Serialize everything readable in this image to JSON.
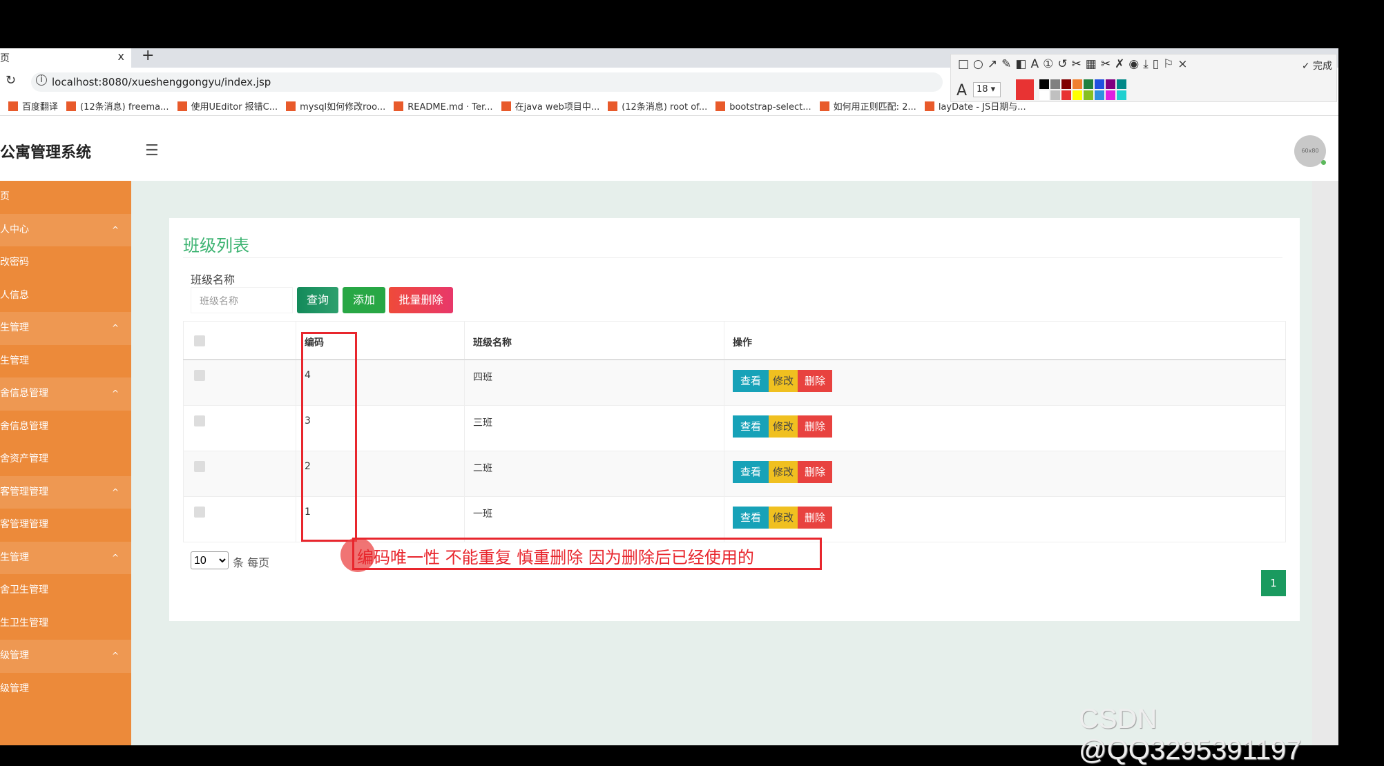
{
  "browser": {
    "tab_title": "页",
    "tab_close": "x",
    "new_tab": "+",
    "url": "localhost:8080/xueshenggongyu/index.jsp",
    "bookmarks": [
      "百度翻译",
      "(12条消息) freema...",
      "使用UEditor 报错C...",
      "mysql如何修改roo...",
      "README.md · Ter...",
      "在java web项目中...",
      "(12条消息) root of...",
      "bootstrap-select...",
      "如何用正则匹配: 2...",
      "layDate - JS日期与..."
    ]
  },
  "snip_toolbar": {
    "tools": "□○↗✎◧A①↺✂▦✂✗◉⤓▯⚐×",
    "done": "✓ 完成",
    "font_icon": "A",
    "font_size": "18 ▾",
    "current_color": "#e83333",
    "palette": [
      "#000000",
      "#808080",
      "#800000",
      "#f08030",
      "#208040",
      "#2050e0",
      "#800080",
      "#008888",
      "#ffffff",
      "#c0c0c0",
      "#e83333",
      "#ffff00",
      "#88c020",
      "#3090e0",
      "#e020e0",
      "#20d0d0"
    ]
  },
  "header": {
    "brand": "公寓管理系统",
    "menu_icon": "hamburger-icon",
    "avatar": "60x80"
  },
  "sidebar": {
    "items": [
      {
        "label": "页",
        "group": false
      },
      {
        "label": "人中心",
        "group": true
      },
      {
        "label": "改密码",
        "group": false
      },
      {
        "label": "人信息",
        "group": false
      },
      {
        "label": "生管理",
        "group": true
      },
      {
        "label": "生管理",
        "group": false
      },
      {
        "label": "舍信息管理",
        "group": true
      },
      {
        "label": "舍信息管理",
        "group": false
      },
      {
        "label": "舍资产管理",
        "group": false
      },
      {
        "label": "客管理管理",
        "group": true
      },
      {
        "label": "客管理管理",
        "group": false
      },
      {
        "label": "生管理",
        "group": true
      },
      {
        "label": "舍卫生管理",
        "group": false
      },
      {
        "label": "生卫生管理",
        "group": false
      },
      {
        "label": "级管理",
        "group": true
      },
      {
        "label": "级管理",
        "group": false
      }
    ],
    "expand_glyph": "^"
  },
  "main": {
    "title": "班级列表",
    "filter_label": "班级名称",
    "filter_placeholder": "班级名称",
    "buttons": {
      "search": "查询",
      "add": "添加",
      "batch_delete": "批量删除"
    },
    "table": {
      "headers": [
        "",
        "编码",
        "班级名称",
        "操作"
      ],
      "rows": [
        {
          "code": "4",
          "name": "四班"
        },
        {
          "code": "3",
          "name": "三班"
        },
        {
          "code": "2",
          "name": "二班"
        },
        {
          "code": "1",
          "name": "一班"
        }
      ],
      "actions": {
        "view": "查看",
        "edit": "修改",
        "delete": "删除"
      }
    },
    "page_size": "10",
    "page_size_label": "条 每页",
    "current_page": "1"
  },
  "annotation": "编码唯一性 不能重复  慎重删除 因为删除后已经使用的",
  "watermark": "CSDN @QQ3295391197",
  "colors": {
    "sidebar": "#ec8a3a",
    "accent": "#3cb371",
    "view": "#17a2b8",
    "edit": "#f0c020",
    "delete": "#e8423f",
    "annotation": "#e8262d"
  }
}
